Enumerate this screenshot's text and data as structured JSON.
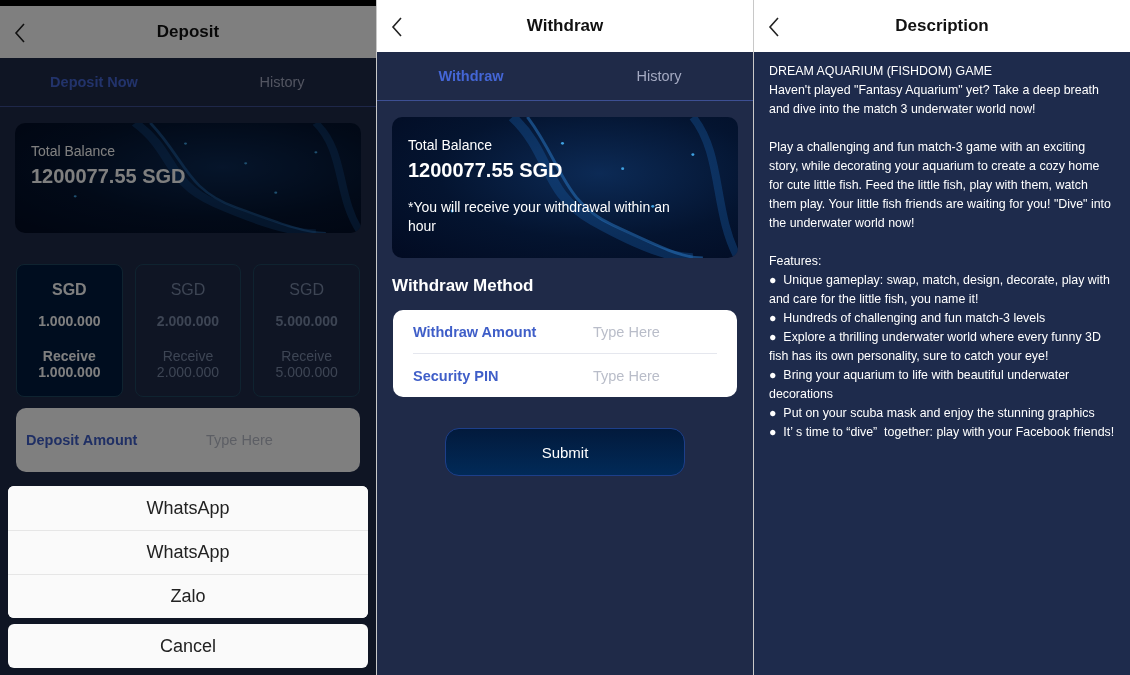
{
  "deposit": {
    "title": "Deposit",
    "tabs": [
      {
        "label": "Deposit Now",
        "selected": true
      },
      {
        "label": "History",
        "selected": false
      }
    ],
    "balance": {
      "label": "Total Balance",
      "amount": "1200077.55 SGD"
    },
    "options": [
      {
        "currency": "SGD",
        "amount": "1.000.000",
        "receive_label": "Receive",
        "receive": "1.000.000",
        "selected": true
      },
      {
        "currency": "SGD",
        "amount": "2.000.000",
        "receive_label": "Receive",
        "receive": "2.000.000",
        "selected": false
      },
      {
        "currency": "SGD",
        "amount": "5.000.000",
        "receive_label": "Receive",
        "receive": "5.000.000",
        "selected": false
      }
    ],
    "amount_field": {
      "label": "Deposit Amount",
      "placeholder": "Type Here"
    },
    "action_sheet": {
      "items": [
        "WhatsApp",
        "WhatsApp",
        "Zalo"
      ],
      "cancel": "Cancel"
    }
  },
  "withdraw": {
    "title": "Withdraw",
    "tabs": [
      {
        "label": "Withdraw",
        "selected": true
      },
      {
        "label": "History",
        "selected": false
      }
    ],
    "balance": {
      "label": "Total Balance",
      "amount": "1200077.55 SGD",
      "note": "*You will receive your withdrawal within an hour"
    },
    "method_title": "Withdraw Method",
    "fields": [
      {
        "label": "Withdraw Amount",
        "placeholder": "Type Here"
      },
      {
        "label": "Security PIN",
        "placeholder": "Type Here"
      }
    ],
    "submit": "Submit"
  },
  "description": {
    "title": "Description",
    "heading": "DREAM AQUARIUM (FISHDOM) GAME",
    "paragraphs": [
      "Haven't played \"Fantasy Aquarium\" yet? Take a deep breath and dive into the match 3 underwater world now!",
      "Play a challenging and fun match-3 game with an exciting story, while decorating your aquarium to create a cozy home for cute little fish. Feed the little fish, play with them, watch them play. Your little fish friends are waiting for you! \"Dive\" into the underwater world now!"
    ],
    "features_title": "Features:",
    "features": [
      "●  Unique gameplay: swap, match, design, decorate, play with and care for the little fish, you name it!",
      "●  Hundreds of challenging and fun match-3 levels",
      "●  Explore a thrilling underwater world where every funny 3D fish has its own personality, sure to catch your eye!",
      "●  Bring your aquarium to life with beautiful underwater decorations",
      "●  Put on your scuba mask and enjoy the stunning graphics",
      "●  It’ s time to “dive”  together: play with your Facebook friends!"
    ]
  }
}
